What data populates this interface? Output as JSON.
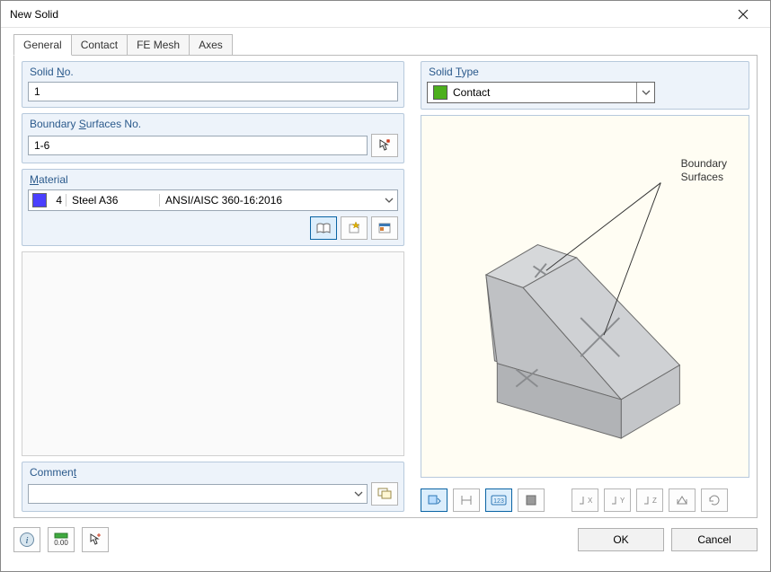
{
  "window": {
    "title": "New Solid"
  },
  "tabs": [
    {
      "label": "General",
      "active": true
    },
    {
      "label": "Contact",
      "active": false
    },
    {
      "label": "FE Mesh",
      "active": false
    },
    {
      "label": "Axes",
      "active": false
    }
  ],
  "groups": {
    "solid_no": {
      "title_pre": "Solid ",
      "title_u": "N",
      "title_post": "o."
    },
    "boundary": {
      "title_pre": "Boundary ",
      "title_u": "S",
      "title_post": "urfaces No."
    },
    "material": {
      "title_u": "M",
      "title_post": "aterial"
    },
    "comment": {
      "title_pre": "Commen",
      "title_u": "t",
      "title_post": ""
    },
    "solid_type": {
      "title_pre": "Solid ",
      "title_u": "T",
      "title_post": "ype"
    }
  },
  "fields": {
    "solid_no": "1",
    "boundary_surfaces": "1-6",
    "comment": "",
    "solid_type_selected": "Contact"
  },
  "material": {
    "swatch": "#4a3fff",
    "number": "4",
    "name": "Steel A36",
    "standard": "ANSI/AISC 360-16:2016"
  },
  "solid_type_swatch": "#4caf1c",
  "preview": {
    "annotation_label": "Boundary\nSurfaces"
  },
  "material_buttons": [
    "library",
    "new",
    "edit"
  ],
  "preview_tools": [
    {
      "name": "display-options-icon",
      "active": true
    },
    {
      "name": "dimension-icon",
      "active": false
    },
    {
      "name": "show-numbers-icon",
      "active": true
    },
    {
      "name": "fill-icon",
      "active": false
    },
    {
      "name": "axis-x-icon",
      "active": false
    },
    {
      "name": "axis-y-icon",
      "active": false
    },
    {
      "name": "axis-z-icon",
      "active": false
    },
    {
      "name": "reset-view-icon",
      "active": false
    },
    {
      "name": "rotate-icon",
      "active": false
    }
  ],
  "bottom_icons": [
    "help-icon",
    "calc-icon",
    "pick-icon"
  ],
  "buttons": {
    "ok": "OK",
    "cancel": "Cancel"
  }
}
